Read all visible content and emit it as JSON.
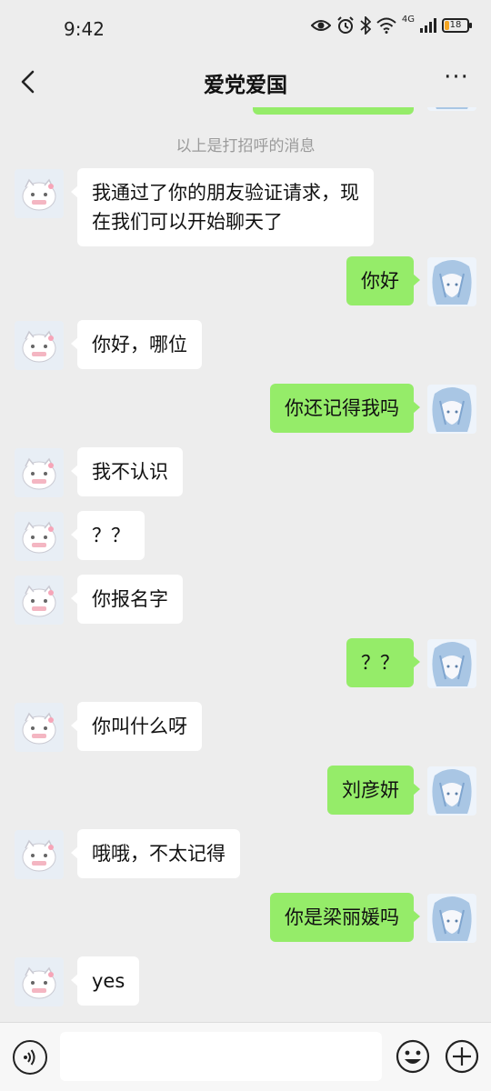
{
  "status_bar": {
    "time": "9:42",
    "network": "4G",
    "battery": "18",
    "icons": [
      "eye-icon",
      "alarm-icon",
      "bluetooth-icon",
      "wifi-icon",
      "signal-icon",
      "battery-icon"
    ]
  },
  "header": {
    "title": "爱党爱国",
    "back_icon": "chevron-left-icon",
    "more_icon": "more-icon",
    "more_label": "···"
  },
  "chat": {
    "system_notice": "以上是打招呼的消息",
    "messages": [
      {
        "side": "in",
        "text": "我通过了你的朋友验证请求，现\n在我们可以开始聊天了"
      },
      {
        "side": "out",
        "text": "你好"
      },
      {
        "side": "in",
        "text": "你好，哪位"
      },
      {
        "side": "out",
        "text": "你还记得我吗"
      },
      {
        "side": "in",
        "text": "我不认识"
      },
      {
        "side": "in",
        "text": "？？"
      },
      {
        "side": "in",
        "text": "你报名字"
      },
      {
        "side": "out",
        "text": "？？"
      },
      {
        "side": "in",
        "text": "你叫什么呀"
      },
      {
        "side": "out",
        "text": "刘彦妍"
      },
      {
        "side": "in",
        "text": "哦哦，不太记得"
      },
      {
        "side": "out",
        "text": "你是梁丽媛吗"
      },
      {
        "side": "in",
        "text": "yes"
      }
    ]
  },
  "input_bar": {
    "value": "",
    "placeholder": "",
    "icons": [
      "voice-icon",
      "emoji-icon",
      "plus-icon"
    ]
  },
  "colors": {
    "background": "#ededed",
    "outgoing_bubble": "#95ec69",
    "incoming_bubble": "#ffffff",
    "battery_accent": "#f5a623"
  }
}
